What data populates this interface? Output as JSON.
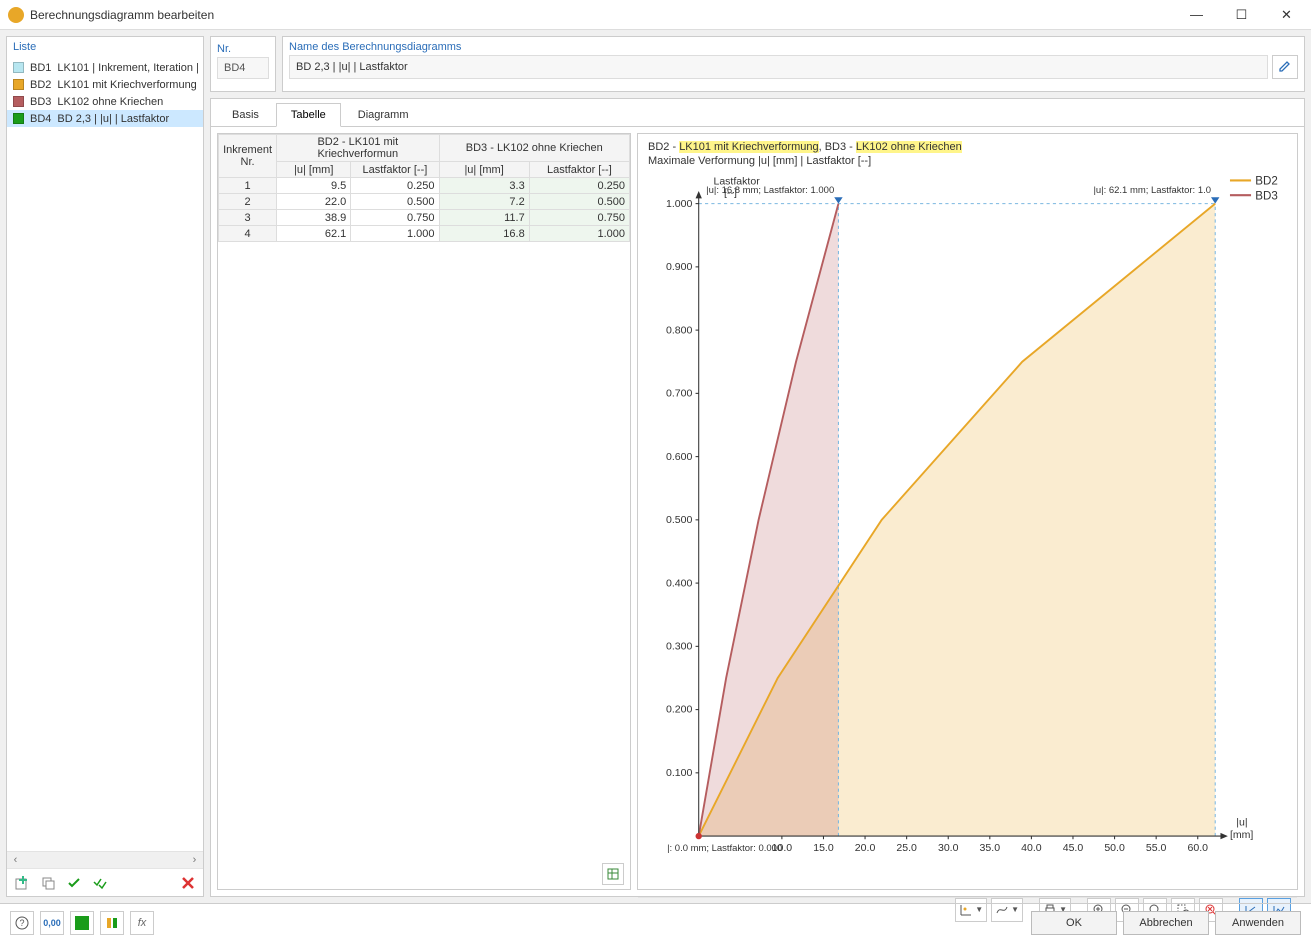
{
  "window": {
    "title": "Berechnungsdiagramm bearbeiten",
    "btn_min": "—",
    "btn_max": "☐",
    "btn_close": "✕"
  },
  "list": {
    "header": "Liste",
    "items": [
      {
        "id": "BD1",
        "color": "#b7e6f0",
        "label": "LK101 | Inkrement, Iteration |"
      },
      {
        "id": "BD2",
        "color": "#e8a728",
        "label": "LK101 mit Kriechverformung"
      },
      {
        "id": "BD3",
        "color": "#b55d5f",
        "label": "LK102 ohne Kriechen"
      },
      {
        "id": "BD4",
        "color": "#1a9c1a",
        "label": "BD 2,3 | |u| | Lastfaktor"
      }
    ],
    "selected": 3,
    "scroll_left": "‹",
    "scroll_right": "›"
  },
  "nr": {
    "label": "Nr.",
    "value": "BD4"
  },
  "name": {
    "label": "Name des Berechnungsdiagramms",
    "value": "BD 2,3 | |u| | Lastfaktor"
  },
  "tabs": {
    "basis": "Basis",
    "tabelle": "Tabelle",
    "diagramm": "Diagramm",
    "active": 1
  },
  "table": {
    "col_inc": "Inkrement\nNr.",
    "group2": "BD2 - LK101 mit Kriechverformun",
    "group3": "BD3 - LK102 ohne Kriechen",
    "col_u": "|u| [mm]",
    "col_lf": "Lastfaktor [--]",
    "rows": [
      {
        "n": "1",
        "u2": "9.5",
        "lf2": "0.250",
        "u3": "3.3",
        "lf3": "0.250"
      },
      {
        "n": "2",
        "u2": "22.0",
        "lf2": "0.500",
        "u3": "7.2",
        "lf3": "0.500"
      },
      {
        "n": "3",
        "u2": "38.9",
        "lf2": "0.750",
        "u3": "11.7",
        "lf3": "0.750"
      },
      {
        "n": "4",
        "u2": "62.1",
        "lf2": "1.000",
        "u3": "16.8",
        "lf3": "1.000"
      }
    ]
  },
  "chart": {
    "title_prefix_bd2": "BD2 - ",
    "title_hl_bd2": "LK101 mit Kriechverformung",
    "title_mid": ", BD3 - ",
    "title_hl_bd3": "LK102 ohne Kriechen",
    "subtitle": "Maximale Verformung |u| [mm] | Lastfaktor [--]",
    "legend": [
      "BD2",
      "BD3"
    ],
    "legend_colors": [
      "#e8a728",
      "#b55d5f"
    ],
    "ylabel": "Lastfaktor\n[--]",
    "xlabel": "|u|\n[mm]",
    "annot_bd3": "|u|: 16.8 mm; Lastfaktor: 1.000",
    "annot_bd2": "|u|: 62.1 mm; Lastfaktor: 1.0",
    "annot_origin": "|: 0.0 mm; Lastfaktor: 0.000",
    "x_ticks": [
      "10.0",
      "15.0",
      "20.0",
      "25.0",
      "30.0",
      "35.0",
      "40.0",
      "45.0",
      "50.0",
      "55.0",
      "60.0"
    ],
    "y_ticks": [
      "0.100",
      "0.200",
      "0.300",
      "0.400",
      "0.500",
      "0.600",
      "0.700",
      "0.800",
      "0.900",
      "1.000"
    ]
  },
  "chart_data": {
    "type": "line",
    "xlabel": "|u| [mm]",
    "ylabel": "Lastfaktor [--]",
    "xlim": [
      0,
      62.1
    ],
    "ylim": [
      0,
      1.0
    ],
    "series": [
      {
        "name": "BD2",
        "color": "#e8a728",
        "x": [
          0,
          9.5,
          22.0,
          38.9,
          62.1
        ],
        "y": [
          0,
          0.25,
          0.5,
          0.75,
          1.0
        ]
      },
      {
        "name": "BD3",
        "color": "#b55d5f",
        "x": [
          0,
          3.3,
          7.2,
          11.7,
          16.8
        ],
        "y": [
          0,
          0.25,
          0.5,
          0.75,
          1.0
        ]
      }
    ]
  },
  "footer": {
    "ok": "OK",
    "cancel": "Abbrechen",
    "apply": "Anwenden"
  }
}
